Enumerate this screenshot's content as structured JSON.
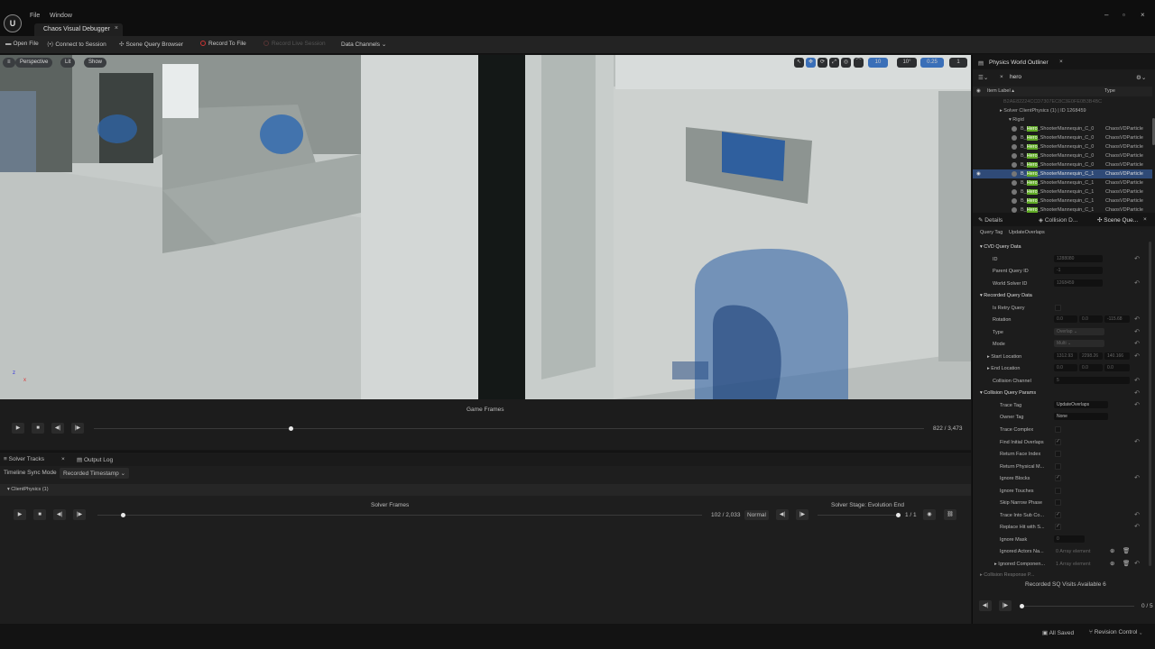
{
  "app": {
    "menu": [
      "File",
      "Window"
    ],
    "tab_title": "Chaos Visual Debugger",
    "tab_close": "×",
    "window_controls": [
      "–",
      "▫",
      "×"
    ]
  },
  "toolbar": {
    "open_file": "Open File",
    "connect": "Connect to Session",
    "scene_query_browser": "Scene Query Browser",
    "record_to_file": "Record To File",
    "record_live": "Record Live Session",
    "data_channels": "Data Channels"
  },
  "viewport": {
    "perspective": "Perspective",
    "lit": "Lit",
    "show": "Show",
    "grid_snap": "10",
    "rot_snap": "10°",
    "scale_snap": "0.25",
    "camera_speed": "1",
    "axis_x": "x",
    "axis_z": "z"
  },
  "game_frames": {
    "label": "Game Frames",
    "counter": "822 / 3,473",
    "progress": 0.237
  },
  "bottom_tabs": {
    "solver_tracks": "Solver Tracks",
    "output_log": "Output Log",
    "close": "×"
  },
  "solver": {
    "sync_mode_label": "Timeline Sync Mode",
    "sync_mode_value": "Recorded Timestamp",
    "track_name": "ClientPhysics (1)",
    "frames_label": "Solver Frames",
    "frames_counter": "102 / 2,033",
    "speed": "Normal",
    "stage_label": "Solver Stage: Evolution End",
    "stage_counter": "1 / 1",
    "progress": 0.042
  },
  "status": {
    "saved": "All Saved",
    "revision": "Revision Control"
  },
  "outliner": {
    "title": "Physics World Outliner",
    "close": "×",
    "search": "hero",
    "col_label": "Item Label",
    "col_type": "Type",
    "guid": "B2AE82224CCD7307EC8C3E0FE0B3B4BC",
    "solver": "Solver ClientPhysics (1) | ID 1268459",
    "group": "Rigid",
    "highlight": "Hero",
    "rows": [
      {
        "prefix": "B_",
        "suffix": "_ShooterMannequin_C_0",
        "type": "ChaosVDParticle"
      },
      {
        "prefix": "B_",
        "suffix": "_ShooterMannequin_C_0",
        "type": "ChaosVDParticle"
      },
      {
        "prefix": "B_",
        "suffix": "_ShooterMannequin_C_0",
        "type": "ChaosVDParticle"
      },
      {
        "prefix": "B_",
        "suffix": "_ShooterMannequin_C_0",
        "type": "ChaosVDParticle"
      },
      {
        "prefix": "B_",
        "suffix": "_ShooterMannequin_C_0",
        "type": "ChaosVDParticle"
      },
      {
        "prefix": "B_",
        "suffix": "_ShooterMannequin_C_1",
        "type": "ChaosVDParticle",
        "selected": true
      },
      {
        "prefix": "B_",
        "suffix": "_ShooterMannequin_C_1",
        "type": "ChaosVDParticle"
      },
      {
        "prefix": "B_",
        "suffix": "_ShooterMannequin_C_1",
        "type": "ChaosVDParticle"
      },
      {
        "prefix": "B_",
        "suffix": "_ShooterMannequin_C_1",
        "type": "ChaosVDParticle"
      },
      {
        "prefix": "B_",
        "suffix": "_ShooterMannequin_C_1",
        "type": "ChaosVDParticle"
      }
    ]
  },
  "details": {
    "tabs": [
      "Details",
      "Collision D...",
      "Scene Que..."
    ],
    "query_tag_label": "Query Tag",
    "query_tag_value": "UpdateOverlaps",
    "sections": {
      "cvd": "CVD Query Data",
      "recorded": "Recorded Query Data",
      "params": "Collision Query Params",
      "response": "Collision Response P..."
    },
    "id": {
      "label": "ID",
      "value": "1288080"
    },
    "parent": {
      "label": "Parent Query ID",
      "value": "-1"
    },
    "world_solver": {
      "label": "World Solver ID",
      "value": "1268459"
    },
    "is_retry": {
      "label": "Is Retry Query"
    },
    "rotation": {
      "label": "Rotation",
      "values": [
        "0.0",
        "0.0",
        "-115.68"
      ]
    },
    "type": {
      "label": "Type",
      "value": "Overlap"
    },
    "mode": {
      "label": "Mode",
      "value": "Multi"
    },
    "start": {
      "label": "Start Location",
      "values": [
        "1312.93",
        "2298.26",
        "140.166"
      ]
    },
    "end": {
      "label": "End Location",
      "values": [
        "0.0",
        "0.0",
        "0.0"
      ]
    },
    "channel": {
      "label": "Collision Channel",
      "value": "5"
    },
    "trace_tag": {
      "label": "Trace Tag",
      "value": "UpdateOverlaps"
    },
    "owner_tag": {
      "label": "Owner Tag",
      "value": "None"
    },
    "checks": [
      {
        "label": "Trace Complex",
        "checked": false
      },
      {
        "label": "Find Initial Overlaps",
        "checked": true
      },
      {
        "label": "Return Face Index",
        "checked": false
      },
      {
        "label": "Return Physical M...",
        "checked": false
      },
      {
        "label": "Ignore Blocks",
        "checked": true
      },
      {
        "label": "Ignore Touches",
        "checked": false
      },
      {
        "label": "Skip Narrow Phase",
        "checked": false
      },
      {
        "label": "Trace Into Sub Co...",
        "checked": true
      },
      {
        "label": "Replace Hit with S...",
        "checked": true
      }
    ],
    "ignore_mask": {
      "label": "Ignore Mask",
      "value": "0"
    },
    "ignored_actors": {
      "label": "Ignored Actors Na...",
      "value": "0 Array element"
    },
    "ignored_components": {
      "label": "Ignored Componen...",
      "value": "1 Array element"
    }
  },
  "recorded": {
    "label": "Recorded SQ Visits Available 6",
    "counter": "0 / 5",
    "progress": 0.0
  }
}
